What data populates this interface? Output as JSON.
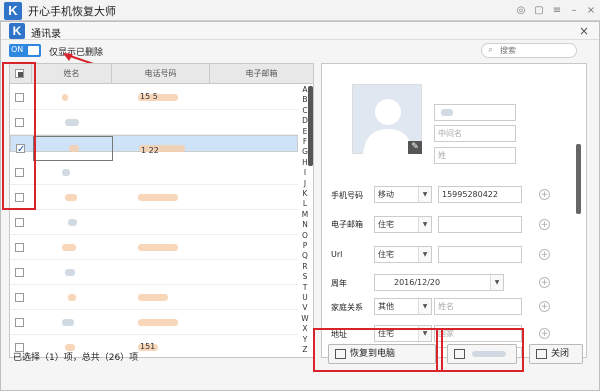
{
  "app": {
    "title": "开心手机恢复大师",
    "logo_letter": "K"
  },
  "dialog": {
    "title": "通讯录",
    "logo_letter": "K",
    "close": "×"
  },
  "filter": {
    "toggle_label": "ON",
    "label": "仅显示已删除"
  },
  "search": {
    "placeholder": "搜索"
  },
  "table": {
    "columns": [
      "姓名",
      "电话号码",
      "电子邮箱"
    ],
    "rows": [
      {
        "checked": false,
        "selected": false,
        "phone_fragment": "15    5"
      },
      {
        "checked": false,
        "selected": false,
        "phone_fragment": ""
      },
      {
        "checked": true,
        "selected": true,
        "phone_fragment": "1    22"
      },
      {
        "checked": false,
        "selected": false,
        "phone_fragment": ""
      },
      {
        "checked": false,
        "selected": false,
        "phone_fragment": ""
      },
      {
        "checked": false,
        "selected": false,
        "phone_fragment": ""
      },
      {
        "checked": false,
        "selected": false,
        "phone_fragment": ""
      },
      {
        "checked": false,
        "selected": false,
        "phone_fragment": ""
      },
      {
        "checked": false,
        "selected": false,
        "phone_fragment": ""
      },
      {
        "checked": false,
        "selected": false,
        "phone_fragment": ""
      },
      {
        "checked": false,
        "selected": false,
        "phone_fragment": "151"
      }
    ],
    "alphabet": [
      "A",
      "B",
      "C",
      "D",
      "E",
      "F",
      "G",
      "H",
      "I",
      "J",
      "K",
      "L",
      "M",
      "N",
      "O",
      "P",
      "Q",
      "R",
      "S",
      "T",
      "U",
      "V",
      "W",
      "X",
      "Y",
      "Z"
    ]
  },
  "status": "已选择（1）项，总共（26）项",
  "detail": {
    "name_first_placeholder": "中间名",
    "name_last_placeholder": "姓",
    "phone": {
      "label": "手机号码",
      "type": "移动",
      "value": "15995280422"
    },
    "email": {
      "label": "电子邮箱",
      "type": "住宅",
      "value": ""
    },
    "url": {
      "label": "Url",
      "type": "住宅",
      "value": ""
    },
    "anniversary": {
      "label": "周年",
      "value": "2016/12/20"
    },
    "family": {
      "label": "家庭关系",
      "type": "其他",
      "placeholder": "姓名"
    },
    "address": {
      "label": "地址",
      "type": "住宅",
      "placeholder": "国家"
    }
  },
  "buttons": {
    "restore_pc": "恢复到电脑",
    "close": "关闭"
  },
  "colors": {
    "accent": "#2f88e0",
    "annotation": "#d9232b",
    "selected_row": "#cfe3f8"
  }
}
